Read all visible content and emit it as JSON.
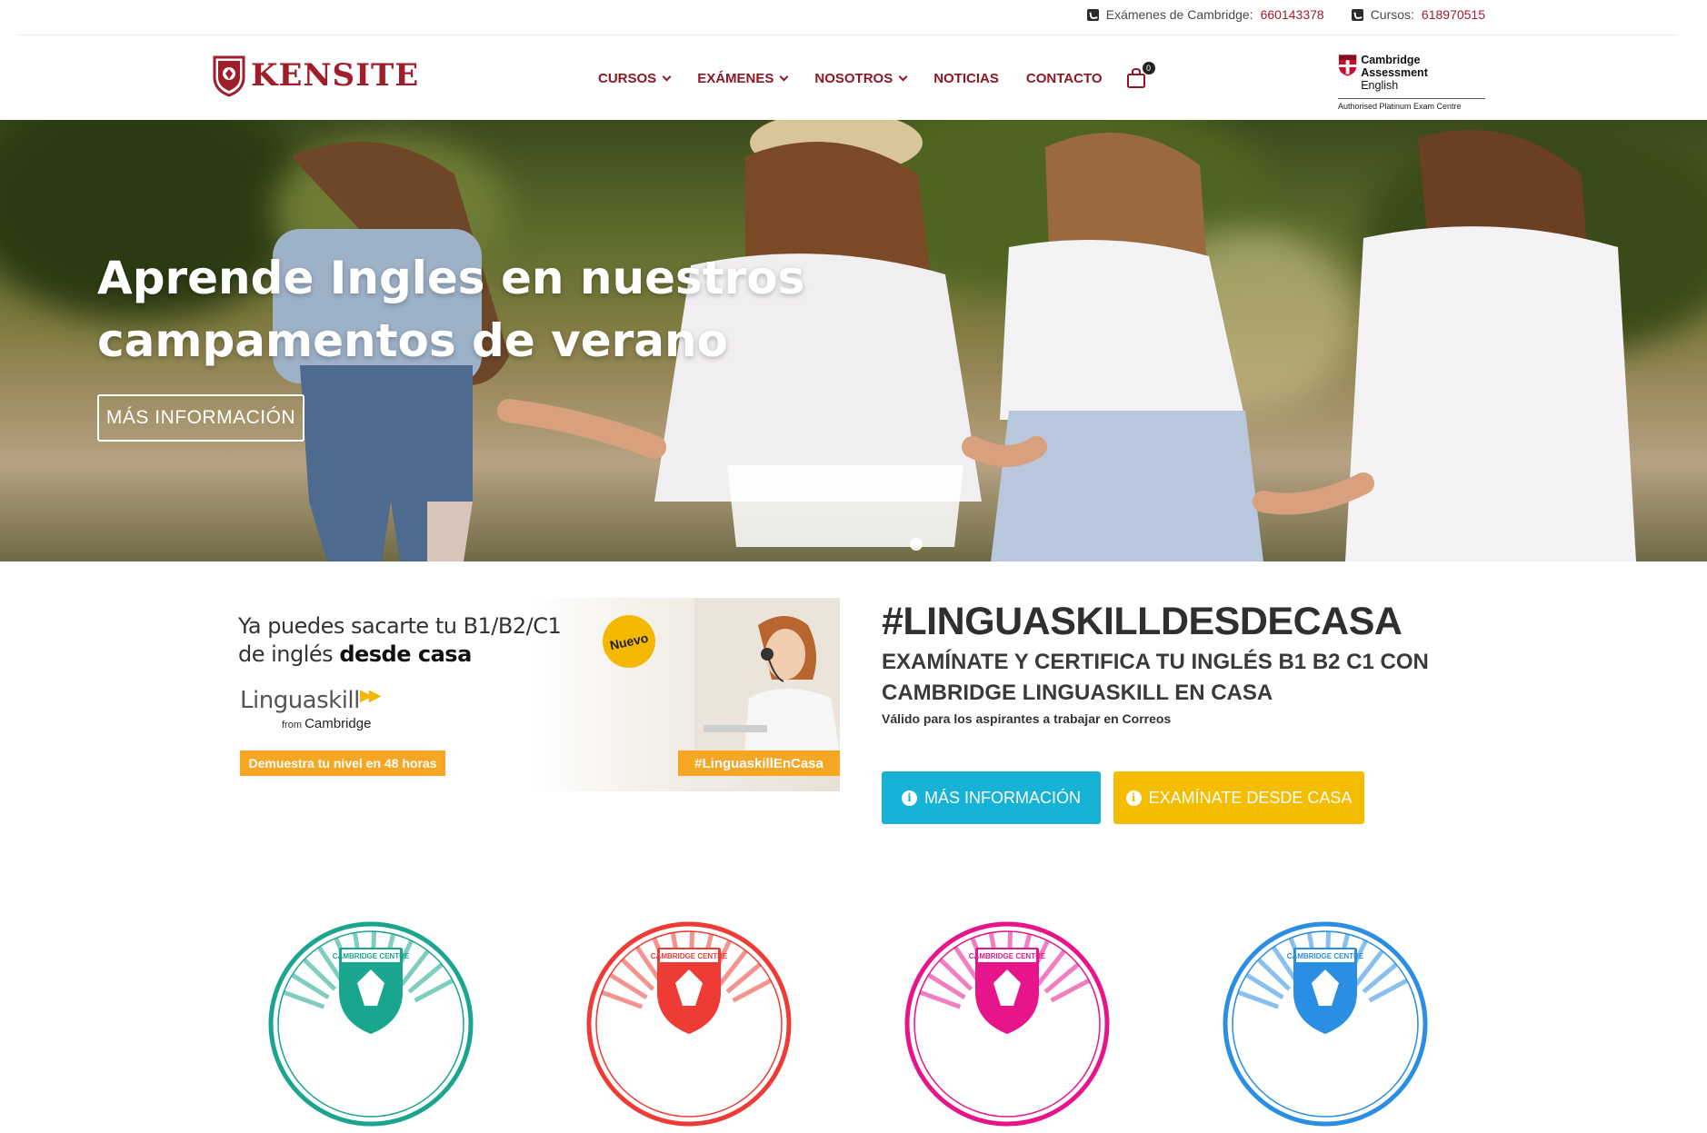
{
  "topbar": {
    "exams_label": "Exámenes de Cambridge:",
    "exams_phone": "660143378",
    "courses_label": "Cursos:",
    "courses_phone": "618970515"
  },
  "header": {
    "logo_text": "KENSITE",
    "nav": [
      {
        "label": "CURSOS",
        "dropdown": true
      },
      {
        "label": "EXÁMENES",
        "dropdown": true
      },
      {
        "label": "NOSOTROS",
        "dropdown": true
      },
      {
        "label": "NOTICIAS",
        "dropdown": false
      },
      {
        "label": "CONTACTO",
        "dropdown": false
      }
    ],
    "cart_count": "0",
    "cambridge": {
      "line1": "Cambridge Assessment",
      "line2": "English",
      "line3": "Authorised Platinum Exam Centre"
    }
  },
  "hero": {
    "title": "Aprende Ingles en nuestros campamentos de verano",
    "button": "MÁS INFORMACIÓN"
  },
  "promo": {
    "banner": {
      "line1": "Ya puedes sacarte tu B1/B2/C1",
      "line2_a": "de inglés ",
      "line2_b": "desde casa",
      "brand": "Linguaskill",
      "from": "from",
      "from_brand": "Cambridge",
      "cta": "Demuestra tu nivel en 48 horas",
      "badge": "Nuevo",
      "hashtag": "#LinguaskillEnCasa"
    },
    "heading": "#LINGUASKILLDESDECASA",
    "subheading": "EXAMÍNATE Y CERTIFICA TU INGLÉS B1 B2 C1 CON CAMBRIDGE LINGUASKILL EN CASA",
    "note": "Válido para los aspirantes a trabajar en Correos",
    "btn_info": "MÁS INFORMACIÓN",
    "btn_exam": "EXAMÍNATE DESDE CASA"
  },
  "seals": [
    {
      "text": "CAMBRIDGE CENTRE",
      "color": "#1aa58f"
    },
    {
      "text": "CAMBRIDGE CENTRE",
      "color": "#ee3b35"
    },
    {
      "text": "CAMBRIDGE CENTRE",
      "color": "#e6158c"
    },
    {
      "text": "CAMBRIDGE CENTRE",
      "color": "#2a8ee3"
    }
  ],
  "colors": {
    "brand": "#a01d2a",
    "nav": "#8e1722",
    "blue_button": "#17b3d6",
    "yellow_button": "#f5bd00",
    "banner_orange": "#f5a623"
  }
}
